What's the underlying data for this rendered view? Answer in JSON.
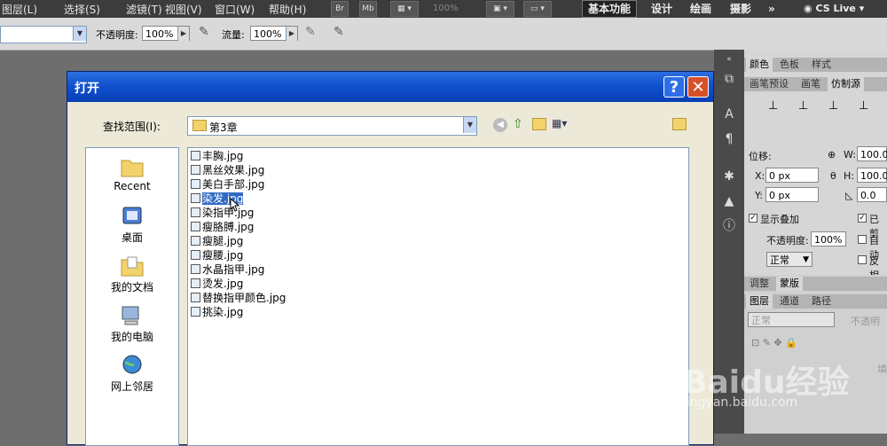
{
  "menubar": {
    "items": [
      "图层(L)",
      "选择(S)",
      "滤镜(T)",
      "视图(V)",
      "窗口(W)",
      "帮助(H)"
    ],
    "br_label": "Br",
    "mb_label": "Mb",
    "zoom": "100%",
    "workspaces": [
      "基本功能",
      "设计",
      "绘画",
      "摄影"
    ],
    "more": "»",
    "cslive": "CS Live"
  },
  "options": {
    "opacity_label": "不透明度:",
    "opacity_value": "100%",
    "flow_label": "流量:",
    "flow_value": "100%"
  },
  "dialog": {
    "title": "打开",
    "help": "?",
    "close": "✕",
    "lookin_label": "查找范围(I):",
    "lookin_value": "第3章",
    "places": [
      "Recent",
      "桌面",
      "我的文档",
      "我的电脑",
      "网上邻居"
    ],
    "files": [
      "丰胸.jpg",
      "黑丝效果.jpg",
      "美白手部.jpg",
      "染发.jpg",
      "染指甲.jpg",
      "瘦胳膊.jpg",
      "瘦腿.jpg",
      "瘦腰.jpg",
      "水晶指甲.jpg",
      "烫发.jpg",
      "替换指甲颜色.jpg",
      "挑染.jpg"
    ],
    "selected_index": 3
  },
  "panel_color": {
    "tabs": [
      "颜色",
      "色板",
      "样式"
    ]
  },
  "panel_clone": {
    "tabs": [
      "画笔预设",
      "画笔",
      "仿制源"
    ],
    "offset_label": "位移:",
    "x_label": "X:",
    "x_value": "0 px",
    "y_label": "Y:",
    "y_value": "0 px",
    "w_label": "W:",
    "w_value": "100.0°",
    "h_label": "H:",
    "h_value": "100.0°",
    "angle_value": "0.0",
    "show_overlay": "显示叠加",
    "opacity_label": "不透明度:",
    "opacity_value": "100%",
    "blend_value": "正常",
    "right_check1": "已剪",
    "right_check2": "自动",
    "right_check3": "反相"
  },
  "panel_adjust": {
    "tabs": [
      "调整",
      "蒙版"
    ]
  },
  "panel_layers": {
    "tabs": [
      "图层",
      "通道",
      "路径"
    ],
    "blend_value": "正常",
    "opacity_label": "不透明",
    "fill_label": "填"
  },
  "watermark": {
    "text": "Baidu经验",
    "url": "jingyan.baidu.com"
  }
}
